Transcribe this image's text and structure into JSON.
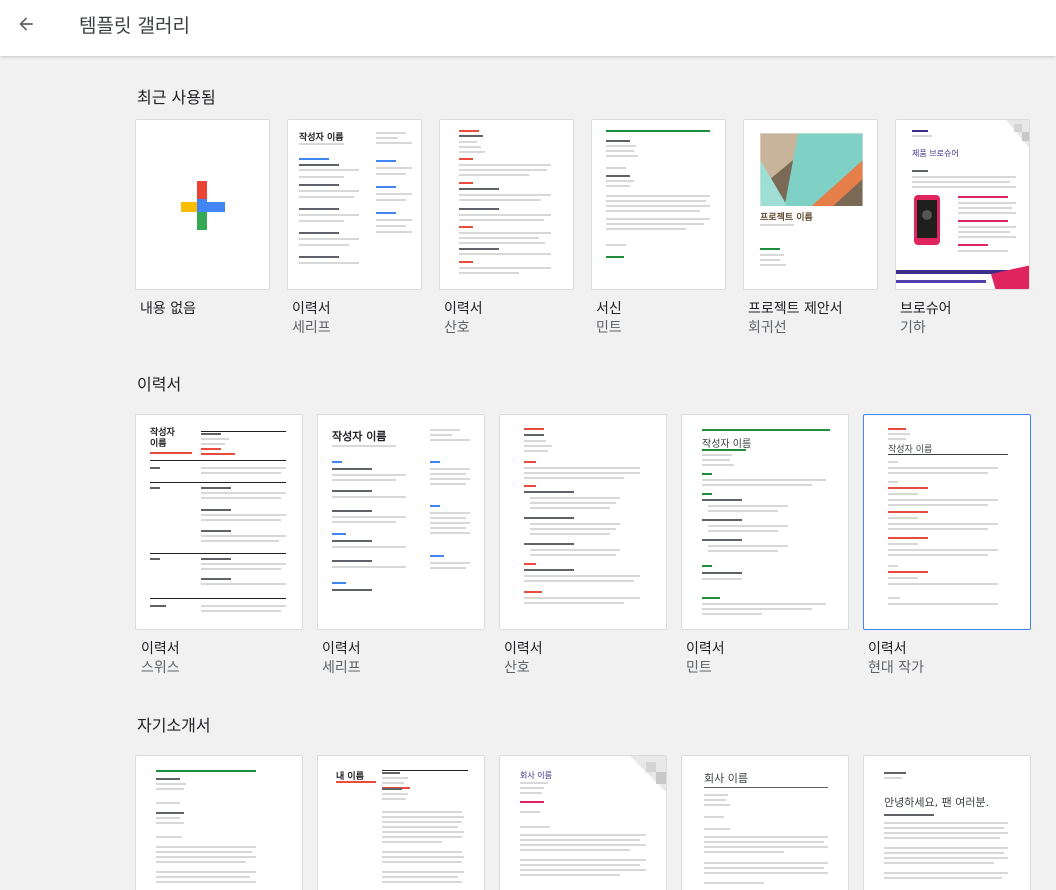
{
  "header": {
    "title": "템플릿 갤러리"
  },
  "sections": {
    "recent": {
      "title": "최근 사용됨",
      "items": [
        {
          "label": "내용 없음",
          "sub": ""
        },
        {
          "label": "이력서",
          "sub": "세리프"
        },
        {
          "label": "이력서",
          "sub": "산호"
        },
        {
          "label": "서신",
          "sub": "민트"
        },
        {
          "label": "프로젝트 제안서",
          "sub": "회귀선"
        },
        {
          "label": "브로슈어",
          "sub": "기하"
        }
      ]
    },
    "resume": {
      "title": "이력서",
      "items": [
        {
          "label": "이력서",
          "sub": "스위스"
        },
        {
          "label": "이력서",
          "sub": "세리프"
        },
        {
          "label": "이력서",
          "sub": "산호"
        },
        {
          "label": "이력서",
          "sub": "민트"
        },
        {
          "label": "이력서",
          "sub": "현대 작가"
        }
      ]
    },
    "letter": {
      "title": "자기소개서"
    }
  },
  "thumbs": {
    "author_name": "작성자 이름",
    "author_name_split": [
      "작성자",
      "이름"
    ],
    "project_name": "프로젝트 이름",
    "product_brochure": "제품 브로슈어",
    "company_name": "회사 이름",
    "my_name": "내 이름",
    "greeting": "안녕하세요, 팬 여러분."
  },
  "colors": {
    "accent_blue": "#4285f4",
    "google_red": "#ea4335",
    "google_yellow": "#fbbc04",
    "google_green": "#34a853",
    "mint": "#1e8e3e",
    "coral": "#e94b3c",
    "tropic_teal": "#7fd1c5",
    "tropic_brown": "#7a6a55",
    "tropic_orange": "#e67e4a",
    "geo_pink": "#e0245e",
    "geo_purple": "#3a2d8c"
  }
}
